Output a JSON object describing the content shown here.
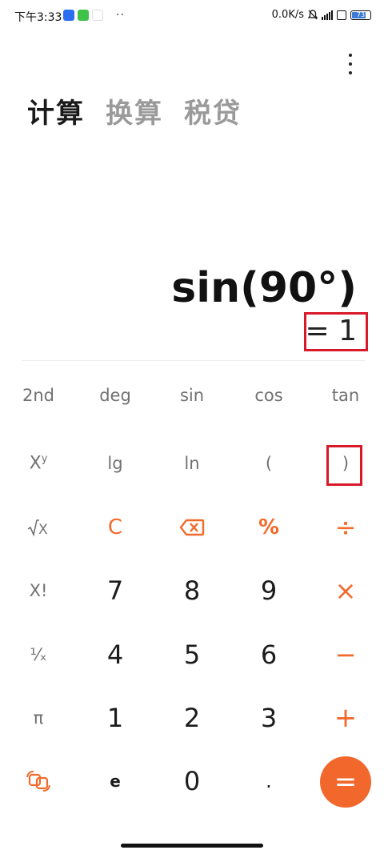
{
  "status_bar": {
    "time": "下午3:33",
    "dots": "··",
    "network_speed": "0.0K/s",
    "battery_level": "73"
  },
  "tabs": [
    {
      "label": "计算",
      "active": true
    },
    {
      "label": "换算",
      "active": false
    },
    {
      "label": "税贷",
      "active": false
    }
  ],
  "display": {
    "expression": "sin(90°)",
    "result": "= 1"
  },
  "keypad": {
    "row1": [
      "2nd",
      "deg",
      "sin",
      "cos",
      "tan"
    ],
    "row2": {
      "ln": "ln",
      "lg": "lg",
      "open_paren": "(",
      "close_paren": ")"
    },
    "row3": {
      "clear": "C",
      "percent": "%",
      "divide": "÷"
    },
    "row4": {
      "factorial": "X!",
      "seven": "7",
      "eight": "8",
      "nine": "9",
      "multiply": "×"
    },
    "row5": {
      "reciprocal": "¹⁄ₓ",
      "four": "4",
      "five": "5",
      "six": "6",
      "minus": "−"
    },
    "row6": {
      "pi": "π",
      "one": "1",
      "two": "2",
      "three": "3",
      "plus": "+"
    },
    "row7": {
      "e": "e",
      "zero": "0",
      "decimal": ".",
      "equals": "="
    }
  },
  "colors": {
    "accent": "#f2682c",
    "highlight_box": "#d7192a",
    "active_tab": "#1a1a1a",
    "inactive_tab": "#9a9a9a"
  }
}
